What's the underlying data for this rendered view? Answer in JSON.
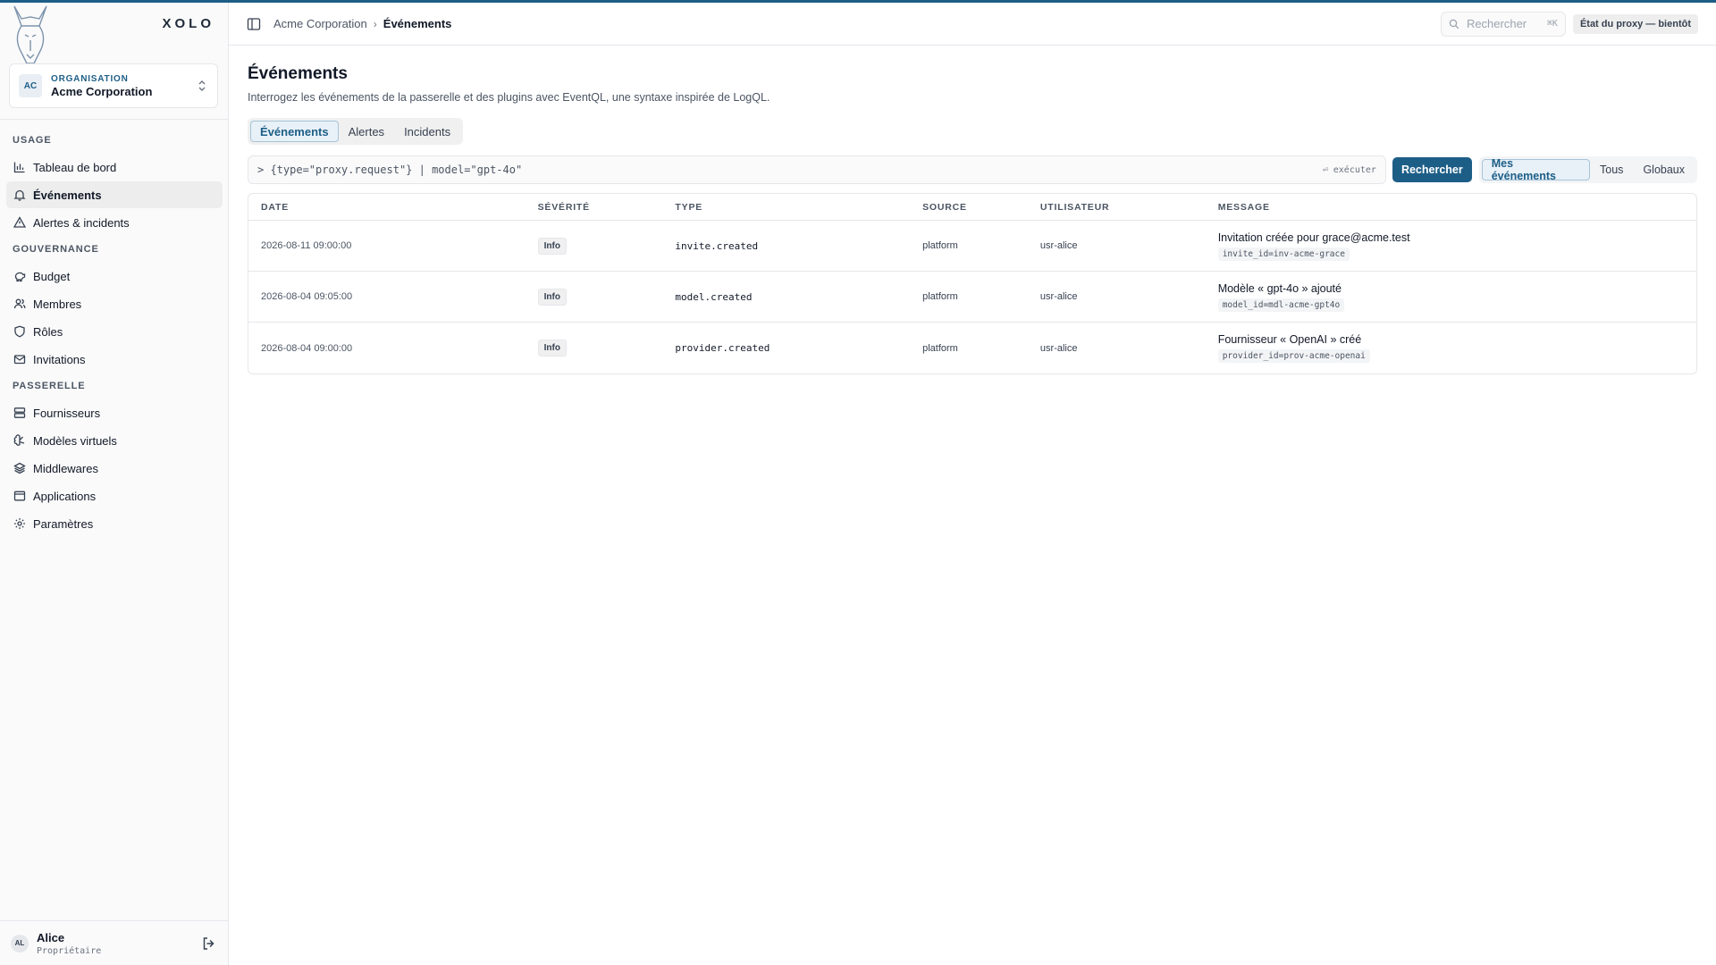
{
  "brand": {
    "name": "XOLO",
    "logo_icon": "dog-head-icon"
  },
  "org": {
    "label": "ORGANISATION",
    "name": "Acme Corporation",
    "initials": "AC"
  },
  "nav": {
    "sections": [
      {
        "title": "USAGE",
        "items": [
          {
            "label": "Tableau de bord",
            "icon": "bar-chart-icon"
          },
          {
            "label": "Événements",
            "icon": "bell-icon",
            "active": true
          },
          {
            "label": "Alertes & incidents",
            "icon": "alert-triangle-icon"
          }
        ]
      },
      {
        "title": "GOUVERNANCE",
        "items": [
          {
            "label": "Budget",
            "icon": "piggy-bank-icon"
          },
          {
            "label": "Membres",
            "icon": "users-icon"
          },
          {
            "label": "Rôles",
            "icon": "shield-icon"
          },
          {
            "label": "Invitations",
            "icon": "mail-icon"
          }
        ]
      },
      {
        "title": "PASSERELLE",
        "items": [
          {
            "label": "Fournisseurs",
            "icon": "server-icon"
          },
          {
            "label": "Modèles virtuels",
            "icon": "brain-icon"
          },
          {
            "label": "Middlewares",
            "icon": "layers-icon"
          },
          {
            "label": "Applications",
            "icon": "app-window-icon"
          },
          {
            "label": "Paramètres",
            "icon": "gear-icon"
          }
        ]
      }
    ]
  },
  "user": {
    "name": "Alice",
    "role": "Propriétaire",
    "initials": "AL"
  },
  "topbar": {
    "breadcrumb": [
      "Acme Corporation",
      "Événements"
    ],
    "search_placeholder": "Rechercher",
    "search_shortcut": "⌘K",
    "proxy_status": "État du proxy — bientôt"
  },
  "page": {
    "title": "Événements",
    "description": "Interrogez les événements de la passerelle et des plugins avec EventQL, une syntaxe inspirée de LogQL.",
    "tabs": [
      "Événements",
      "Alertes",
      "Incidents"
    ],
    "active_tab": 0,
    "query": "> {type=\"proxy.request\"} | model=\"gpt-4o\"",
    "run_hint": "⏎ exécuter",
    "search_button": "Rechercher",
    "scopes": [
      "Mes événements",
      "Tous",
      "Globaux"
    ],
    "active_scope": 0
  },
  "table": {
    "columns": [
      "DATE",
      "SÉVÉRITÉ",
      "TYPE",
      "SOURCE",
      "UTILISATEUR",
      "MESSAGE"
    ],
    "rows": [
      {
        "date": "2026-08-11 09:00:00",
        "severity": "Info",
        "type": "invite.created",
        "source": "platform",
        "user": "usr-alice",
        "message": "Invitation créée pour grace@acme.test",
        "meta": "invite_id=inv-acme-grace"
      },
      {
        "date": "2026-08-04 09:05:00",
        "severity": "Info",
        "type": "model.created",
        "source": "platform",
        "user": "usr-alice",
        "message": "Modèle « gpt-4o » ajouté",
        "meta": "model_id=mdl-acme-gpt4o"
      },
      {
        "date": "2026-08-04 09:00:00",
        "severity": "Info",
        "type": "provider.created",
        "source": "platform",
        "user": "usr-alice",
        "message": "Fournisseur « OpenAI » créé",
        "meta": "provider_id=prov-acme-openai"
      }
    ]
  }
}
